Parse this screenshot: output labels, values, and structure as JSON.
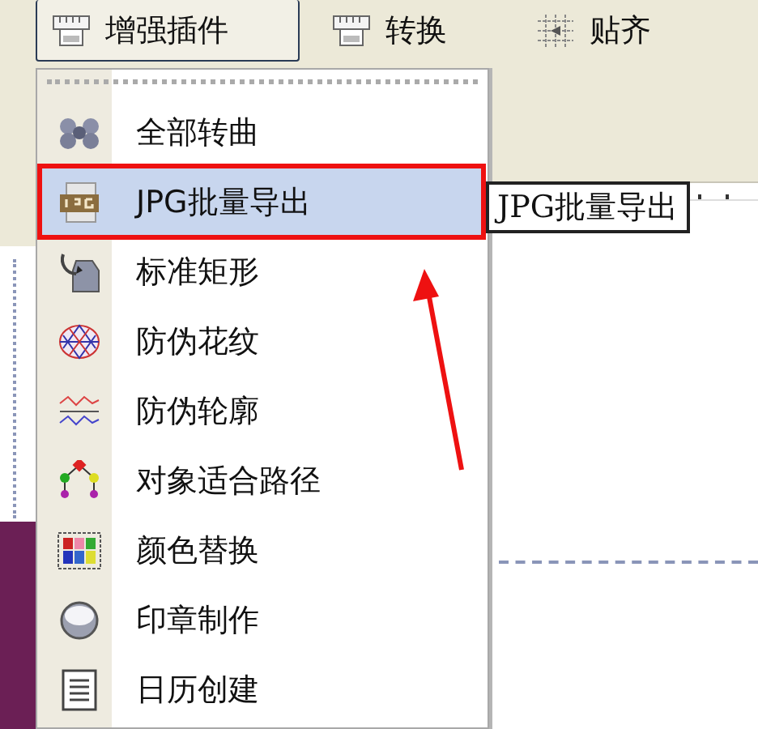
{
  "toolbar": {
    "buttons": [
      {
        "label": "增强插件",
        "selected": true
      },
      {
        "label": "转换",
        "selected": false
      },
      {
        "label": "贴齐",
        "selected": false
      }
    ]
  },
  "menu": {
    "items": [
      {
        "label": "全部转曲",
        "selected": false
      },
      {
        "label": "JPG批量导出",
        "selected": true
      },
      {
        "label": "标准矩形",
        "selected": false
      },
      {
        "label": "防伪花纹",
        "selected": false
      },
      {
        "label": "防伪轮廓",
        "selected": false
      },
      {
        "label": "对象适合路径",
        "selected": false
      },
      {
        "label": "颜色替换",
        "selected": false
      },
      {
        "label": "印章制作",
        "selected": false
      },
      {
        "label": "日历创建",
        "selected": false
      }
    ]
  },
  "tooltip": "JPG批量导出"
}
